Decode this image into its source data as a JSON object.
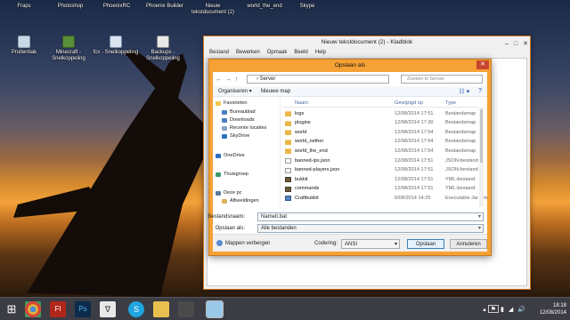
{
  "desktop": {
    "top_icons": [
      "Fraps",
      "Photoshop",
      "PhoenixRC",
      "Phoenix Builder",
      "Nieuw tekstdocument (2)",
      "world_the_end",
      "Skype"
    ],
    "icons": [
      {
        "label": "Prullenbak",
        "icon": "recycle-bin-icon"
      },
      {
        "label": "Minecraft - Snelkoppeling",
        "icon": "minecraft-icon"
      },
      {
        "label": "fcx - Snelkoppeling",
        "icon": "plane-icon"
      },
      {
        "label": "Backups - Snelkoppeling",
        "icon": "backup-icon"
      }
    ]
  },
  "notepad": {
    "title": "Nieuw tekstdocument (2) - Kladblok",
    "menu": [
      "Bestand",
      "Bewerken",
      "Opmaak",
      "Beeld",
      "Help"
    ],
    "controls": {
      "minimize": "–",
      "maximize": "□",
      "close": "✕"
    }
  },
  "save_dialog": {
    "title": "Opslaan als",
    "close": "✕",
    "address": {
      "path": "Server",
      "separator": "›",
      "back": "←",
      "forward": "→",
      "up": "↑"
    },
    "search_placeholder": "Zoeken in Server",
    "toolbar": {
      "organize": "Organiseren ▾",
      "new_folder": "Nieuwe map",
      "view": "☷ ▾",
      "help": "?"
    },
    "nav": {
      "favorites": "Favorieten",
      "fav_items": [
        "Bureaublad",
        "Downloads",
        "Recente locaties",
        "SkyDrive"
      ],
      "onedrive": "OneDrive",
      "homegroup": "Thuisgroep",
      "thispc": "Deze pc",
      "pc_items": [
        "Afbeeldingen"
      ]
    },
    "columns": {
      "name": "Naam",
      "date": "Gewijzigd op",
      "type": "Type"
    },
    "files": [
      {
        "name": "logs",
        "date": "12/08/2014 17:51",
        "type": "Bestandsmap",
        "kind": "folder"
      },
      {
        "name": "plugins",
        "date": "12/08/2014 17:30",
        "type": "Bestandsmap",
        "kind": "folder"
      },
      {
        "name": "world",
        "date": "12/08/2014 17:54",
        "type": "Bestandsmap",
        "kind": "folder"
      },
      {
        "name": "world_nether",
        "date": "12/08/2014 17:54",
        "type": "Bestandsmap",
        "kind": "folder"
      },
      {
        "name": "world_the_end",
        "date": "12/08/2014 17:54",
        "type": "Bestandsmap",
        "kind": "folder"
      },
      {
        "name": "banned-ips.json",
        "date": "12/08/2014 17:51",
        "type": "JSON-bestand",
        "kind": "doc"
      },
      {
        "name": "banned-players.json",
        "date": "12/08/2014 17:51",
        "type": "JSON-bestand",
        "kind": "doc"
      },
      {
        "name": "bukkit",
        "date": "12/08/2014 17:51",
        "type": "YML-bestand",
        "kind": "yml"
      },
      {
        "name": "commands",
        "date": "12/08/2014 17:51",
        "type": "YML-bestand",
        "kind": "yml"
      },
      {
        "name": "Craftbukkit",
        "date": "6/08/2014 14:25",
        "type": "Executable Jar File",
        "kind": "exe"
      }
    ],
    "filename_label": "Bestandsnaam:",
    "filename_value": "Nameit.bat",
    "savetype_label": "Opslaan als:",
    "savetype_value": "Alle bestanden",
    "hide_folders": "Mappen verbergen",
    "encoding_label": "Codering:",
    "encoding_value": "ANSI",
    "save_button": "Opslaan",
    "cancel_button": "Annuleren"
  },
  "taskbar": {
    "time": "18:18",
    "date": "12/08/2014",
    "tray_symbols": [
      "▴",
      "⚑",
      "▮",
      "◢",
      "🔊"
    ],
    "keyboard_icon": "keyboard-icon",
    "apps": [
      "start",
      "chrome",
      "flash",
      "photoshop",
      "fraps",
      "skype",
      "explorer",
      "game",
      "notepad"
    ]
  },
  "colors": {
    "accent": "#f5a135",
    "taskbar": "#3b3c44",
    "link": "#1e5aa8"
  }
}
